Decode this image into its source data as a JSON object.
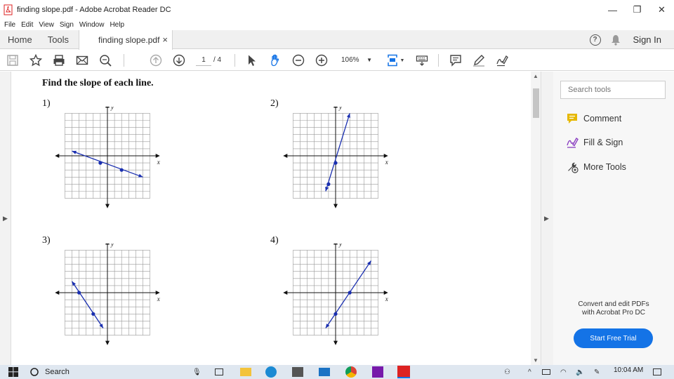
{
  "window": {
    "title": "finding slope.pdf - Adobe Acrobat Reader DC",
    "minimize": "—",
    "maximize": "❐",
    "close": "✕"
  },
  "menu": [
    "File",
    "Edit",
    "View",
    "Sign",
    "Window",
    "Help"
  ],
  "tabs": {
    "home": "Home",
    "tools": "Tools",
    "document": "finding slope.pdf",
    "document_close": "×",
    "help": "?",
    "sign_in": "Sign In"
  },
  "toolbar": {
    "page_current": "1",
    "page_total": "/ 4",
    "zoom": "106%",
    "icons": [
      "save-icon",
      "bookmark-star-icon",
      "print-icon",
      "email-icon",
      "zoom-search-icon",
      "page-up-icon",
      "page-down-icon",
      "select-cursor-icon",
      "hand-icon",
      "zoom-out-icon",
      "zoom-in-icon",
      "fit-page-icon",
      "keyboard-icon",
      "comment-icon",
      "highlight-pen-icon",
      "sign-icon"
    ]
  },
  "document": {
    "heading": "Find the slope of each line.",
    "problems": [
      {
        "label": "1)",
        "axis_x": "x",
        "axis_y": "y"
      },
      {
        "label": "2)",
        "axis_x": "x",
        "axis_y": "y"
      },
      {
        "label": "3)",
        "axis_x": "x",
        "axis_y": "y"
      },
      {
        "label": "4)",
        "axis_x": "x",
        "axis_y": "y"
      }
    ]
  },
  "side_panel": {
    "search_placeholder": "Search tools",
    "items": [
      {
        "label": "Comment",
        "icon": "comment-icon",
        "color": "#e6b800"
      },
      {
        "label": "Fill & Sign",
        "icon": "fill-sign-icon",
        "color": "#8a3fc1"
      },
      {
        "label": "More Tools",
        "icon": "more-tools-icon",
        "color": "#444444"
      }
    ],
    "promo_line1": "Convert and edit PDFs",
    "promo_line2": "with Acrobat Pro DC",
    "trial_button": "Start Free Trial"
  },
  "taskbar": {
    "search": "Search",
    "time": "10:04 AM"
  },
  "colors": {
    "accent": "#1473e6",
    "line_color": "#1a2fb0"
  }
}
